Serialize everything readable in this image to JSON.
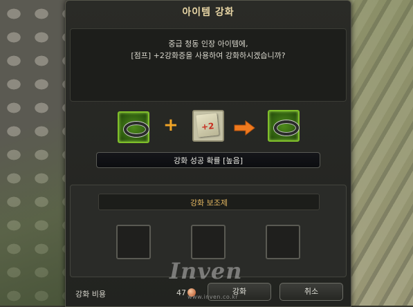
{
  "dialog": {
    "title": "아이템 강화",
    "message_line1": "중급 청동 인장 아이템에,",
    "message_line2": "[점프] +2강화증을 사용하여 강화하시겠습니까?",
    "plus_symbol": "+",
    "scroll_label": "+2",
    "success_rate": "강화 성공 확률 [높음]",
    "assist_title": "강화 보조제",
    "cost_label": "강화 비용",
    "cost_value": "47",
    "enhance_button": "강화",
    "cancel_button": "취소"
  },
  "watermark": {
    "logo": "Inven",
    "url": "www.inven.co.kr"
  },
  "colors": {
    "title": "#e9d7a6",
    "assist_title": "#e3b761",
    "slot_green": "#7fbf2a",
    "arrow_orange": "#f07a1e",
    "plus_orange": "#f0a426"
  },
  "icons": {
    "ring_item": "ring-icon",
    "scroll_item": "enhance-scroll-icon",
    "arrow": "arrow-right-icon",
    "coin": "coin-icon"
  }
}
